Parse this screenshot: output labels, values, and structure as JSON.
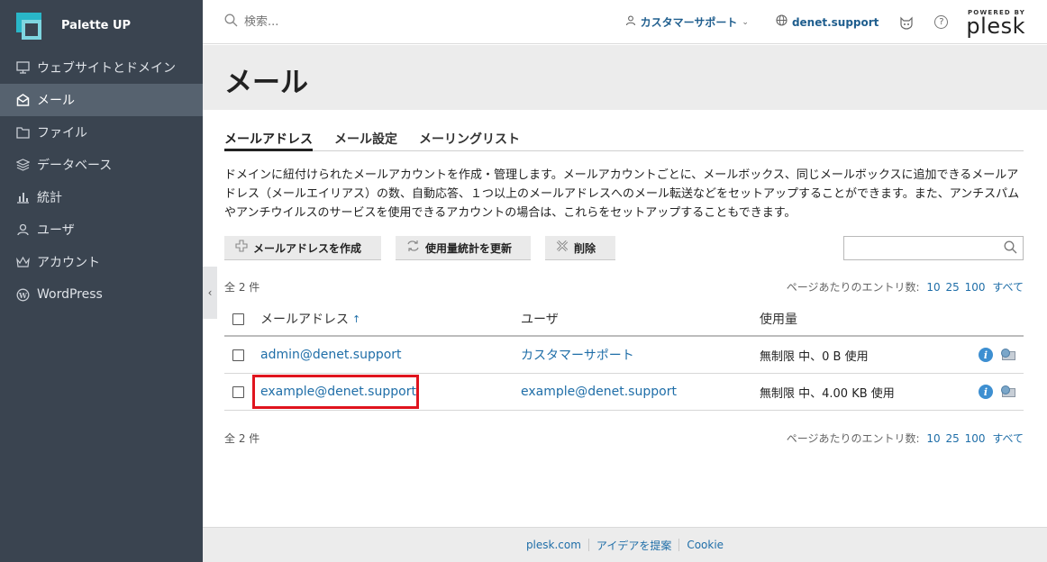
{
  "app": {
    "name": "Palette UP"
  },
  "sidebar": {
    "items": [
      {
        "label": "ウェブサイトとドメイン",
        "icon": "monitor-icon"
      },
      {
        "label": "メール",
        "icon": "mail-icon"
      },
      {
        "label": "ファイル",
        "icon": "folder-icon"
      },
      {
        "label": "データベース",
        "icon": "database-icon"
      },
      {
        "label": "統計",
        "icon": "chart-icon"
      },
      {
        "label": "ユーザ",
        "icon": "user-icon"
      },
      {
        "label": "アカウント",
        "icon": "crown-icon"
      },
      {
        "label": "WordPress",
        "icon": "wordpress-icon"
      }
    ],
    "active_index": 1
  },
  "topbar": {
    "search_placeholder": "検索...",
    "user_label": "カスタマーサポート",
    "domain_label": "denet.support",
    "powered_by": "POWERED BY",
    "brand_word": "plesk"
  },
  "page": {
    "title": "メール"
  },
  "tabs": [
    {
      "label": "メールアドレス",
      "active": true
    },
    {
      "label": "メール設定",
      "active": false
    },
    {
      "label": "メーリングリスト",
      "active": false
    }
  ],
  "description": "ドメインに紐付けられたメールアカウントを作成・管理します。メールアカウントごとに、メールボックス、同じメールボックスに追加できるメールアドレス（メールエイリアス）の数、自動応答、１つ以上のメールアドレスへのメール転送などをセットアップすることができます。また、アンチスパムやアンチウイルスのサービスを使用できるアカウントの場合は、これらをセットアップすることもできます。",
  "toolbar": {
    "create_label": "メールアドレスを作成",
    "refresh_label": "使用量統計を更新",
    "delete_label": "削除"
  },
  "list": {
    "total_label": "全 2 件",
    "per_page_label": "ページあたりのエントリ数:",
    "per_page_options": [
      "10",
      "25",
      "100",
      "すべて"
    ],
    "columns": {
      "email": "メールアドレス",
      "user": "ユーザ",
      "usage": "使用量"
    },
    "sort_indicator": "↑",
    "rows": [
      {
        "email": "admin@denet.support",
        "user": "カスタマーサポート",
        "usage": "無制限 中、0 B 使用"
      },
      {
        "email": "example@denet.support",
        "user": "example@denet.support",
        "usage": "無制限 中、4.00 KB 使用"
      }
    ]
  },
  "footer": {
    "links": [
      "plesk.com",
      "アイデアを提案",
      "Cookie"
    ]
  },
  "colors": {
    "sidebar_bg": "#3a4450",
    "sidebar_active": "#56626f",
    "link": "#1f6ea8",
    "highlight": "#e0141e",
    "brand_accent": "#29b6c8"
  }
}
